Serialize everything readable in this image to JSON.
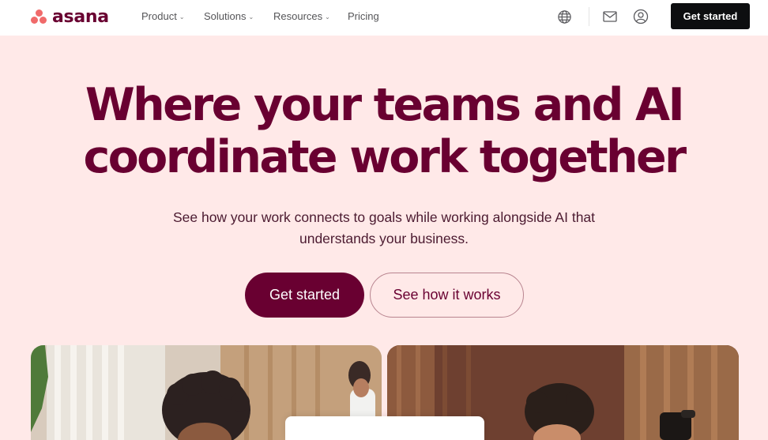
{
  "brand": {
    "logo_text": "asana",
    "logo_color": "#690031",
    "dot_color": "#f06a6a"
  },
  "nav": {
    "items": [
      {
        "label": "Product",
        "has_dropdown": true
      },
      {
        "label": "Solutions",
        "has_dropdown": true
      },
      {
        "label": "Resources",
        "has_dropdown": true
      },
      {
        "label": "Pricing",
        "has_dropdown": false
      }
    ],
    "icons": [
      "globe-icon",
      "mail-icon",
      "user-icon"
    ],
    "cta_label": "Get started"
  },
  "hero": {
    "title_line1": "Where your teams and AI",
    "title_line2": "coordinate work together",
    "subtitle_line1": "See how your work connects to goals while working alongside AI that",
    "subtitle_line2": "understands your business.",
    "primary_label": "Get started",
    "secondary_label": "See how it works"
  },
  "colors": {
    "background": "#ffe9e8",
    "accent": "#690031",
    "cta_dark": "#0d0e10"
  }
}
